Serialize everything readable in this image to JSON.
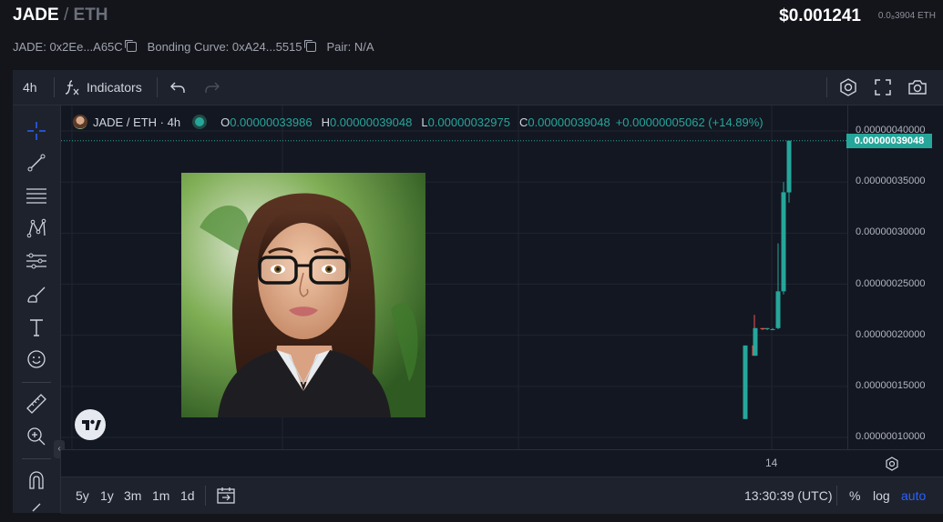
{
  "header": {
    "token_symbol": "JADE",
    "separator": "/",
    "quote": "ETH",
    "price_usd": "$0.001241",
    "price_eth": "0.0₈3904 ETH",
    "meta": {
      "token_addr": "JADE: 0x2Ee...A65C",
      "bonding_curve": "Bonding Curve: 0xA24...5515",
      "pair": "Pair: N/A"
    }
  },
  "toolbar": {
    "interval": "4h",
    "indicators_label": "Indicators"
  },
  "legend": {
    "title": "JADE / ETH · 4h",
    "o_key": "O",
    "o_val": "0.00000033986",
    "h_key": "H",
    "h_val": "0.00000039048",
    "l_key": "L",
    "l_val": "0.00000032975",
    "c_key": "C",
    "c_val": "0.00000039048",
    "change": "+0.00000005062 (+14.89%)"
  },
  "price_scale": {
    "labels": [
      "0.00000040000",
      "0.00000035000",
      "0.00000030000",
      "0.00000025000",
      "0.00000020000",
      "0.00000015000",
      "0.00000010000"
    ],
    "last_price": "0.00000039048"
  },
  "time_scale": {
    "labels": [
      "14"
    ]
  },
  "bottom_toolbar": {
    "ranges": [
      "5y",
      "1y",
      "3m",
      "1m",
      "1d"
    ],
    "clock": "13:30:39 (UTC)",
    "percent": "%",
    "log": "log",
    "auto": "auto"
  },
  "chart_data": {
    "type": "candlestick",
    "title": "JADE / ETH · 4h",
    "ylim": [
      1e-07,
      4e-07
    ],
    "x_tick_labels": [
      "14"
    ],
    "colors": {
      "up": "#26a69a",
      "down": "#ef5350"
    },
    "candles": [
      {
        "o": 1.18e-07,
        "h": 1.9e-07,
        "l": 1.18e-07,
        "c": 1.9e-07
      },
      {
        "o": 1.9e-07,
        "h": 2.2e-07,
        "l": 1.8e-07,
        "c": 1.8e-07
      },
      {
        "o": 1.8e-07,
        "h": 2.07e-07,
        "l": 1.8e-07,
        "c": 2.07e-07
      },
      {
        "o": 2.07e-07,
        "h": 2.07e-07,
        "l": 2.05e-07,
        "c": 2.06e-07
      },
      {
        "o": 2.06e-07,
        "h": 2.07e-07,
        "l": 2.05e-07,
        "c": 2.07e-07
      },
      {
        "o": 2.06e-07,
        "h": 2.07e-07,
        "l": 2.05e-07,
        "c": 2.06e-07
      },
      {
        "o": 2.07e-07,
        "h": 2.9e-07,
        "l": 2.06e-07,
        "c": 2.43e-07
      },
      {
        "o": 2.43e-07,
        "h": 3.5e-07,
        "l": 2.4e-07,
        "c": 3.4e-07
      },
      {
        "o": 3.3986e-07,
        "h": 3.9048e-07,
        "l": 3.2975e-07,
        "c": 3.9048e-07
      }
    ]
  }
}
